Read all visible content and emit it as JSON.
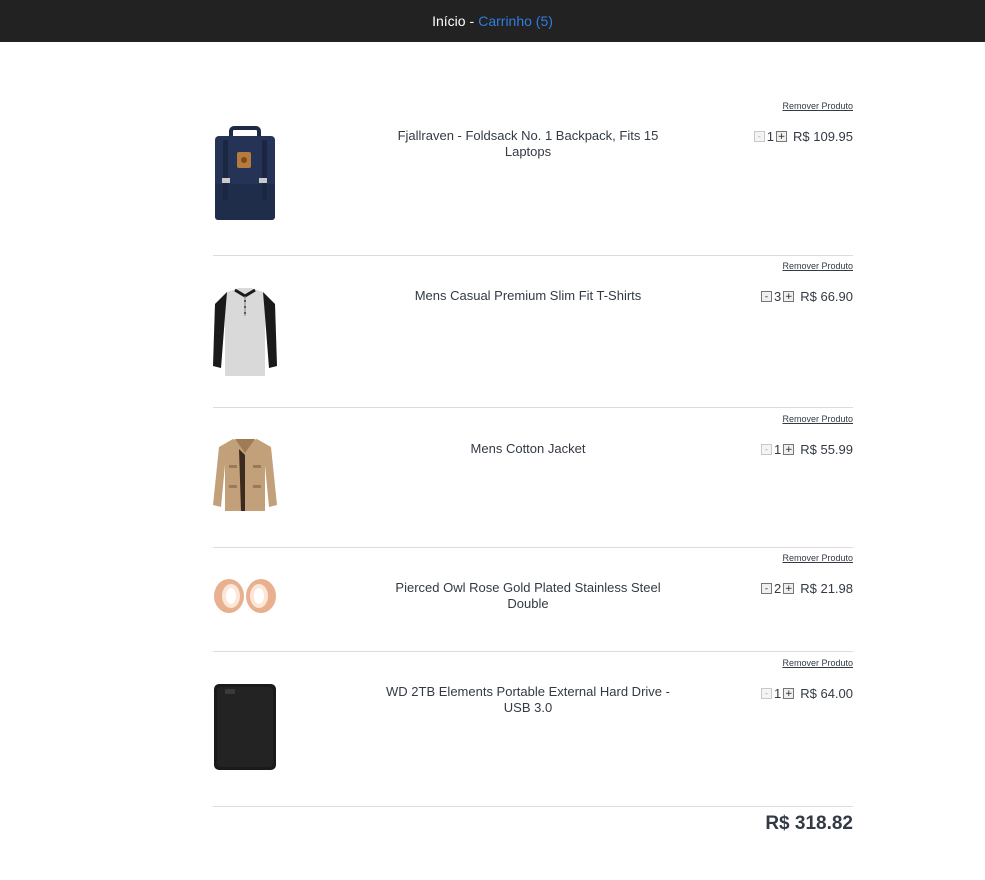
{
  "nav": {
    "home_label": "Início",
    "separator": "-",
    "cart_label": "Carrinho (5)"
  },
  "cart": {
    "remove_label": "Remover Produto",
    "items": [
      {
        "title": "Fjallraven - Foldsack No. 1 Backpack, Fits 15 Laptops",
        "qty": "1",
        "price": "R$ 109.95",
        "image": "backpack-image",
        "minus_disabled": true
      },
      {
        "title": "Mens Casual Premium Slim Fit T-Shirts",
        "qty": "3",
        "price": "R$ 66.90",
        "image": "tshirt-image",
        "minus_disabled": false
      },
      {
        "title": "Mens Cotton Jacket",
        "qty": "1",
        "price": "R$ 55.99",
        "image": "jacket-image",
        "minus_disabled": true
      },
      {
        "title": "Pierced Owl Rose Gold Plated Stainless Steel Double",
        "qty": "2",
        "price": "R$ 21.98",
        "image": "earrings-image",
        "minus_disabled": false
      },
      {
        "title": "WD 2TB Elements Portable External Hard Drive - USB 3.0",
        "qty": "1",
        "price": "R$ 64.00",
        "image": "harddrive-image",
        "minus_disabled": true
      }
    ],
    "minus_label": "-",
    "plus_label": "+",
    "total": "R$ 318.82"
  }
}
